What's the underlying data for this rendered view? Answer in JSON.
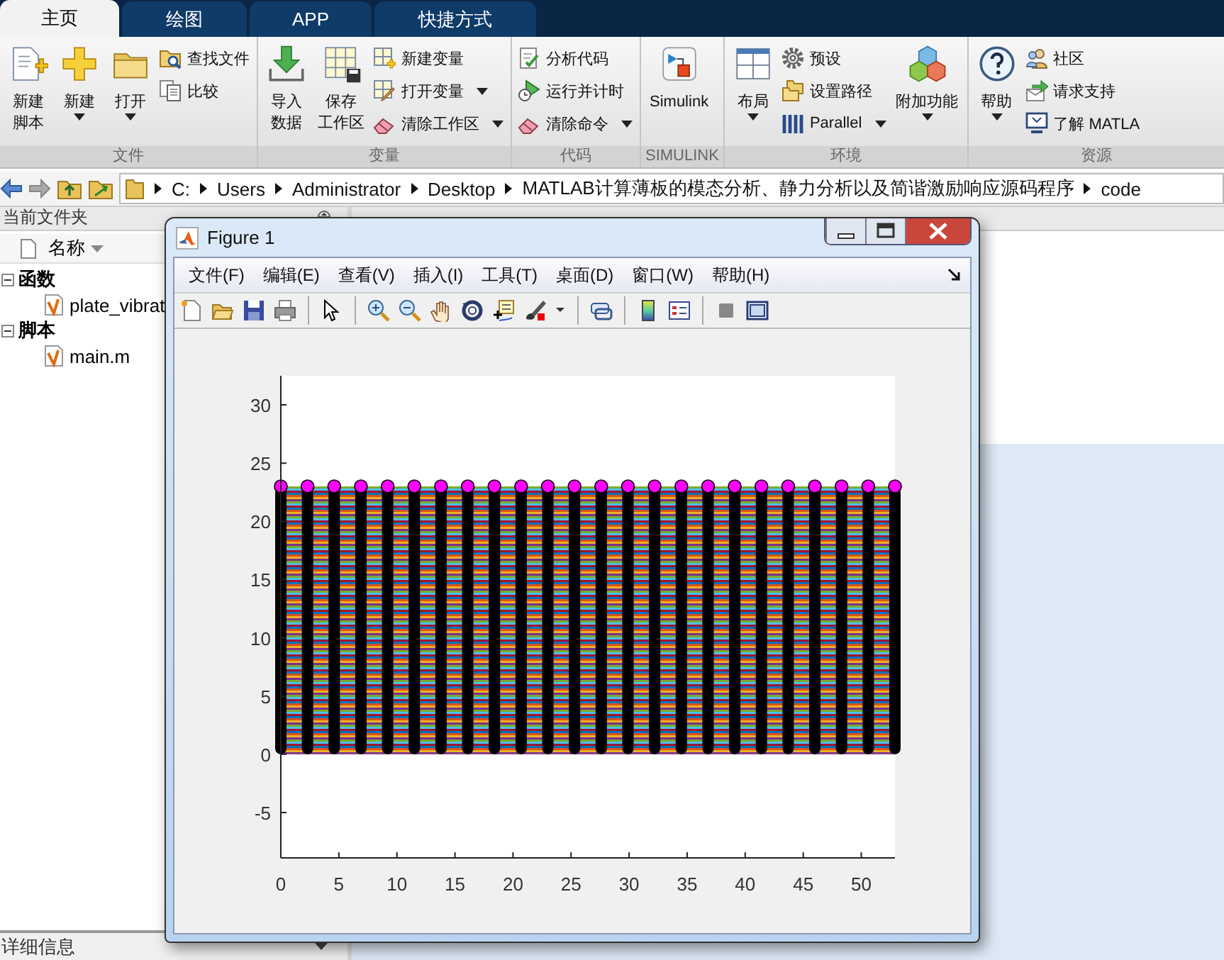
{
  "tabs": [
    {
      "label": "主页",
      "selected": true
    },
    {
      "label": "绘图",
      "selected": false
    },
    {
      "label": "APP",
      "selected": false
    },
    {
      "label": "快捷方式",
      "selected": false
    }
  ],
  "toolstrip": {
    "groups": [
      {
        "label": "文件",
        "columns": [
          {
            "kind": "large",
            "lines": [
              "新建",
              "脚本"
            ],
            "dropdown": false
          },
          {
            "kind": "large",
            "lines": [
              "新建"
            ],
            "dropdown": true
          },
          {
            "kind": "large",
            "lines": [
              "打开"
            ],
            "dropdown": true
          },
          {
            "kind": "small",
            "items": [
              {
                "label": "查找文件",
                "dropdown": false
              },
              {
                "label": "比较",
                "dropdown": false
              }
            ]
          }
        ]
      },
      {
        "label": "变量",
        "columns": [
          {
            "kind": "large",
            "lines": [
              "导入",
              "数据"
            ],
            "dropdown": false
          },
          {
            "kind": "large",
            "lines": [
              "保存",
              "工作区"
            ],
            "dropdown": false
          },
          {
            "kind": "small",
            "items": [
              {
                "label": "新建变量",
                "dropdown": false
              },
              {
                "label": "打开变量",
                "dropdown": true
              },
              {
                "label": "清除工作区",
                "dropdown": true
              }
            ]
          }
        ]
      },
      {
        "label": "代码",
        "columns": [
          {
            "kind": "small",
            "items": [
              {
                "label": "分析代码",
                "dropdown": false
              },
              {
                "label": "运行并计时",
                "dropdown": false
              },
              {
                "label": "清除命令",
                "dropdown": true
              }
            ]
          }
        ]
      },
      {
        "label": "SIMULINK",
        "columns": [
          {
            "kind": "large",
            "lines": [
              "Simulink"
            ],
            "dropdown": false
          }
        ]
      },
      {
        "label": "环境",
        "columns": [
          {
            "kind": "large",
            "lines": [
              "布局"
            ],
            "dropdown": true
          },
          {
            "kind": "small",
            "items": [
              {
                "label": "预设",
                "dropdown": false
              },
              {
                "label": "设置路径",
                "dropdown": false
              },
              {
                "label": "Parallel",
                "dropdown": true
              }
            ]
          },
          {
            "kind": "large",
            "lines": [
              "附加功能"
            ],
            "dropdown": true
          }
        ]
      },
      {
        "label": "资源",
        "columns": [
          {
            "kind": "large",
            "lines": [
              "帮助"
            ],
            "dropdown": true
          },
          {
            "kind": "small",
            "items": [
              {
                "label": "社区",
                "dropdown": false
              },
              {
                "label": "请求支持",
                "dropdown": false
              },
              {
                "label": "了解 MATLA",
                "dropdown": false
              }
            ]
          }
        ]
      }
    ]
  },
  "address_bar": {
    "path": [
      "C:",
      "Users",
      "Administrator",
      "Desktop",
      "MATLAB计算薄板的模态分析、静力分析以及简谐激励响应源码程序",
      "code"
    ]
  },
  "file_panel": {
    "title": "当前文件夹",
    "column": "名称",
    "tree": [
      {
        "label": "函数",
        "expanded": true,
        "children": [
          {
            "label": "plate_vibrat"
          }
        ]
      },
      {
        "label": "脚本",
        "expanded": true,
        "children": [
          {
            "label": "main.m"
          }
        ]
      }
    ],
    "details": "详细信息"
  },
  "figure": {
    "title": "Figure 1",
    "menu": [
      "文件(F)",
      "编辑(E)",
      "查看(V)",
      "插入(I)",
      "工具(T)",
      "桌面(D)",
      "窗口(W)",
      "帮助(H)"
    ],
    "chart_data": {
      "type": "scatter",
      "x": [
        0,
        2.3,
        4.6,
        6.9,
        9.2,
        11.5,
        13.8,
        16.1,
        18.4,
        20.7,
        23,
        25.3,
        27.6,
        29.9,
        32.2,
        34.5,
        36.8,
        39.1,
        41.4,
        43.7,
        46,
        48.3,
        50.6,
        52.9
      ],
      "series": [
        {
          "color": "#ff00ff",
          "values": [
            23,
            23,
            23,
            23,
            23,
            23,
            23,
            23,
            23,
            23,
            23,
            23,
            23,
            23,
            23,
            23,
            23,
            23,
            23,
            23,
            23,
            23,
            23,
            23
          ]
        }
      ],
      "xlim": [
        0,
        52.9
      ],
      "ylim": [
        -8.9,
        32.5
      ],
      "xticks": [
        0,
        5,
        10,
        15,
        20,
        25,
        30,
        35,
        40,
        45,
        50
      ],
      "yticks": [
        -5,
        0,
        5,
        10,
        15,
        20,
        25,
        30
      ]
    }
  }
}
